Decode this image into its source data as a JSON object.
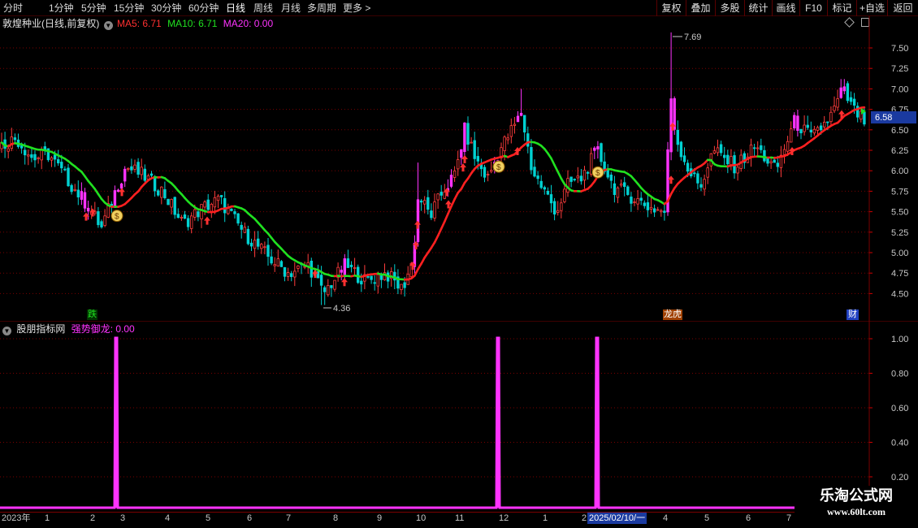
{
  "toolbar": {
    "timeframes": [
      "分时",
      "1分钟",
      "5分钟",
      "15分钟",
      "30分钟",
      "60分钟",
      "日线",
      "周线",
      "月线",
      "多周期",
      "更多 >"
    ],
    "right_buttons": [
      "复权",
      "叠加",
      "多股",
      "统计",
      "画线",
      "F10",
      "标记",
      "+自选",
      "返回"
    ]
  },
  "main_info": {
    "title": "敦煌种业(日线,前复权)",
    "ma5": "MA5: 6.71",
    "ma10": "MA10: 6.71",
    "ma20": "MA20: 0.00"
  },
  "indicator_info": {
    "name": "股朋指标网",
    "series": "强势御龙: 0.00"
  },
  "price_axis": [
    "7.50",
    "7.25",
    "7.00",
    "6.75",
    "6.50",
    "6.25",
    "6.00",
    "5.75",
    "5.50",
    "5.25",
    "5.00",
    "4.75",
    "4.50"
  ],
  "current_price": "6.58",
  "high_label": "7.69",
  "low_label": "4.36",
  "markers": {
    "fall": "跌",
    "dragon": "龙虎",
    "finance": "财"
  },
  "indicator_axis": [
    "1.00",
    "0.80",
    "0.60",
    "0.40",
    "0.20"
  ],
  "date_labels": [
    "2023年",
    "1",
    "2",
    "3",
    "4",
    "5",
    "6",
    "7",
    "8",
    "9",
    "10",
    "11",
    "12",
    "1",
    "2",
    "2025/02/10/一",
    "4",
    "5",
    "6",
    "7"
  ],
  "watermark": {
    "line1": "乐淘公式网",
    "line2": "www.60lt.com"
  },
  "colors": {
    "up": "#ff3c3c",
    "down": "#00d2d2",
    "ma_up": "#ff2020",
    "ma_down": "#20e020",
    "indicator": "#ff33ff",
    "grid": "#7a0000"
  },
  "chart_data": {
    "type": "candlestick",
    "y_range": [
      4.36,
      7.69
    ],
    "indicator_spikes": [
      1,
      1,
      1
    ],
    "indicator_range": [
      0,
      1
    ]
  }
}
